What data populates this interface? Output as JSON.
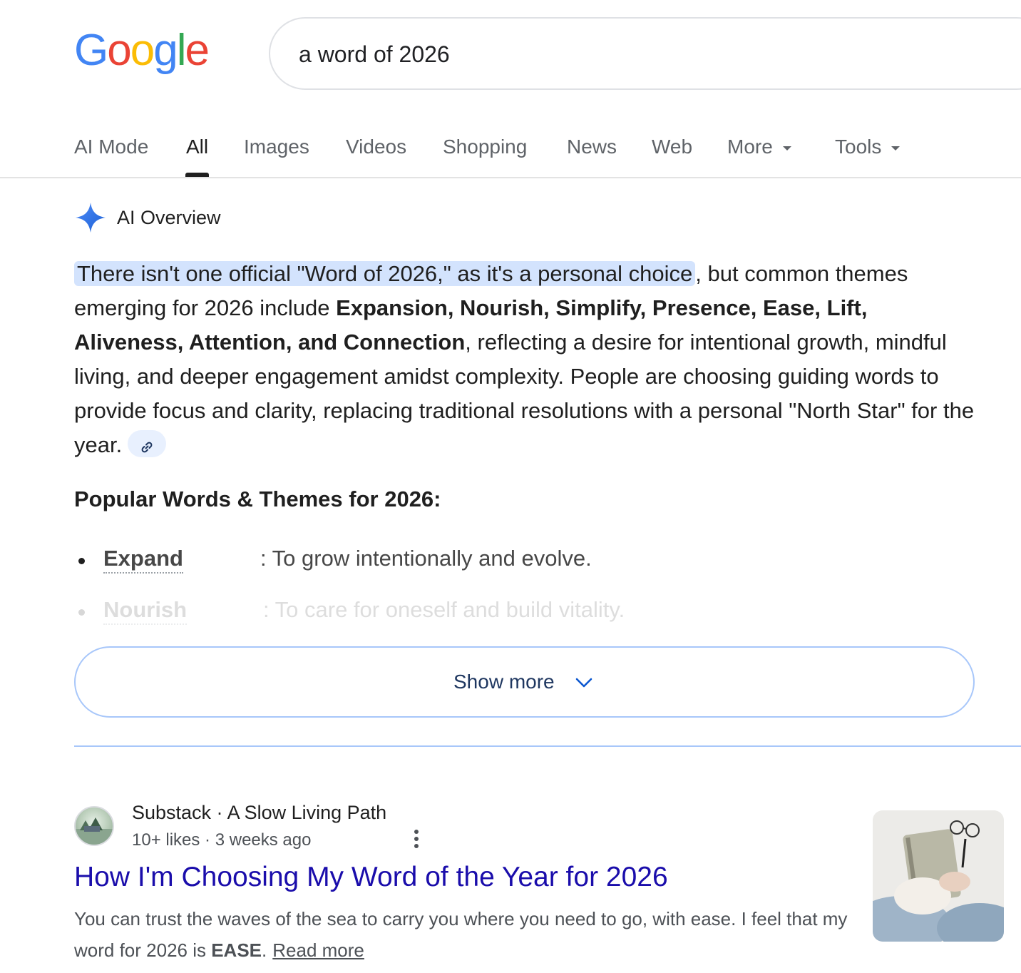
{
  "logo": {
    "letters": [
      "G",
      "o",
      "o",
      "g",
      "l",
      "e"
    ],
    "colors": [
      "#4285F4",
      "#EA4335",
      "#FBBC05",
      "#4285F4",
      "#34A853",
      "#EA4335"
    ]
  },
  "search": {
    "query": "a word of 2026"
  },
  "tabs": [
    {
      "label": "AI Mode"
    },
    {
      "label": "All",
      "active": true
    },
    {
      "label": "Images"
    },
    {
      "label": "Videos"
    },
    {
      "label": "Shopping"
    },
    {
      "label": "News"
    },
    {
      "label": "Web"
    },
    {
      "label": "More"
    },
    {
      "label": "Tools"
    }
  ],
  "ai_overview": {
    "title": "AI Overview",
    "highlight": "There isn't one official \"Word of 2026,\" as it's a personal choice",
    "p1": ", but common themes emerging for 2026 include ",
    "bold1": "Expansion, Nourish, Simplify, Presence, Ease, Lift, Aliveness, Attention, and Connection",
    "p2": ", reflecting a desire for intentional growth, mindful living, and deeper engagement amidst complexity. People are choosing guiding words to provide focus and clarity, replacing traditional resolutions with a personal \"North Star\" for the year.",
    "subheading": "Popular Words & Themes for 2026:",
    "bullets": [
      {
        "term": "Expand",
        "desc": ": To grow intentionally and evolve."
      },
      {
        "term": "Nourish",
        "desc": ": To care for oneself and build vitality."
      }
    ],
    "show_more": "Show more"
  },
  "result": {
    "source": "Substack · A Slow Living Path",
    "meta": "10+ likes · 3 weeks ago",
    "title": "How I'm Choosing My Word of the Year for 2026",
    "snippet_a": "You can trust the waves of the sea to carry you where you need to go, with ease. I feel that my word for 2026 is ",
    "snippet_bold": "EASE",
    "snippet_b": ".",
    "read_more": "Read more"
  },
  "colors": {
    "link_title": "#1a0dab",
    "highlight_bg": "#d3e3fd",
    "accent_blue": "#0b57d0"
  }
}
